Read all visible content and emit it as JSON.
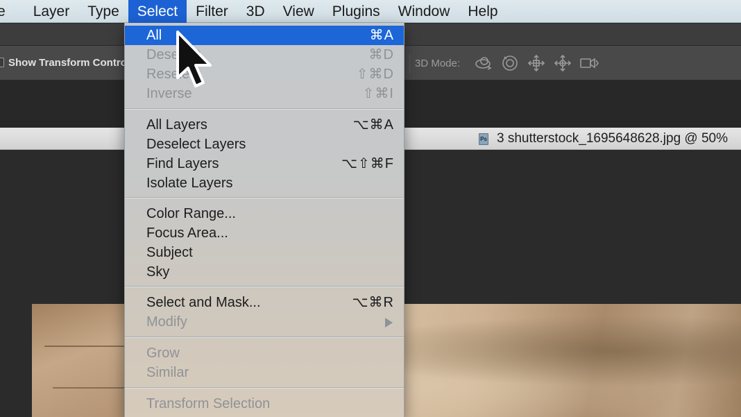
{
  "menubar": {
    "items": [
      {
        "label": "e"
      },
      {
        "label": "Layer"
      },
      {
        "label": "Type"
      },
      {
        "label": "Select"
      },
      {
        "label": "Filter"
      },
      {
        "label": "3D"
      },
      {
        "label": "View"
      },
      {
        "label": "Plugins"
      },
      {
        "label": "Window"
      },
      {
        "label": "Help"
      }
    ],
    "active": "Select"
  },
  "options_bar": {
    "show_transform_label": "Show Transform Control",
    "mode_label": "3D Mode:",
    "icons": [
      "3d-orbit-icon",
      "3d-roll-icon",
      "3d-drag-icon",
      "3d-slide-icon",
      "3d-camera-icon"
    ]
  },
  "document": {
    "icon_text": "Ps",
    "tab_title": "3 shutterstock_1695648628.jpg @ 50%"
  },
  "dropdown": {
    "items": [
      {
        "label": "All",
        "shortcut": "⌘A",
        "state": "highlighted"
      },
      {
        "label": "Deselect",
        "shortcut": "⌘D",
        "state": "disabled"
      },
      {
        "label": "Reselect",
        "shortcut": "⇧⌘D",
        "state": "disabled"
      },
      {
        "label": "Inverse",
        "shortcut": "⇧⌘I",
        "state": "disabled"
      },
      {
        "label": "All Layers",
        "shortcut": "⌥⌘A",
        "state": "enabled"
      },
      {
        "label": "Deselect Layers",
        "shortcut": "",
        "state": "enabled"
      },
      {
        "label": "Find Layers",
        "shortcut": "⌥⇧⌘F",
        "state": "enabled"
      },
      {
        "label": "Isolate Layers",
        "shortcut": "",
        "state": "enabled"
      },
      {
        "label": "Color Range...",
        "shortcut": "",
        "state": "enabled"
      },
      {
        "label": "Focus Area...",
        "shortcut": "",
        "state": "enabled"
      },
      {
        "label": "Subject",
        "shortcut": "",
        "state": "enabled"
      },
      {
        "label": "Sky",
        "shortcut": "",
        "state": "enabled"
      },
      {
        "label": "Select and Mask...",
        "shortcut": "⌥⌘R",
        "state": "enabled"
      },
      {
        "label": "Modify",
        "shortcut": "",
        "state": "disabled",
        "submenu": true
      },
      {
        "label": "Grow",
        "shortcut": "",
        "state": "disabled"
      },
      {
        "label": "Similar",
        "shortcut": "",
        "state": "disabled"
      },
      {
        "label": "Transform Selection",
        "shortcut": "",
        "state": "disabled"
      }
    ]
  },
  "colors": {
    "highlight": "#1c66d8",
    "menu_active": "#1d62d4",
    "disabled_text": "#8f9296"
  }
}
